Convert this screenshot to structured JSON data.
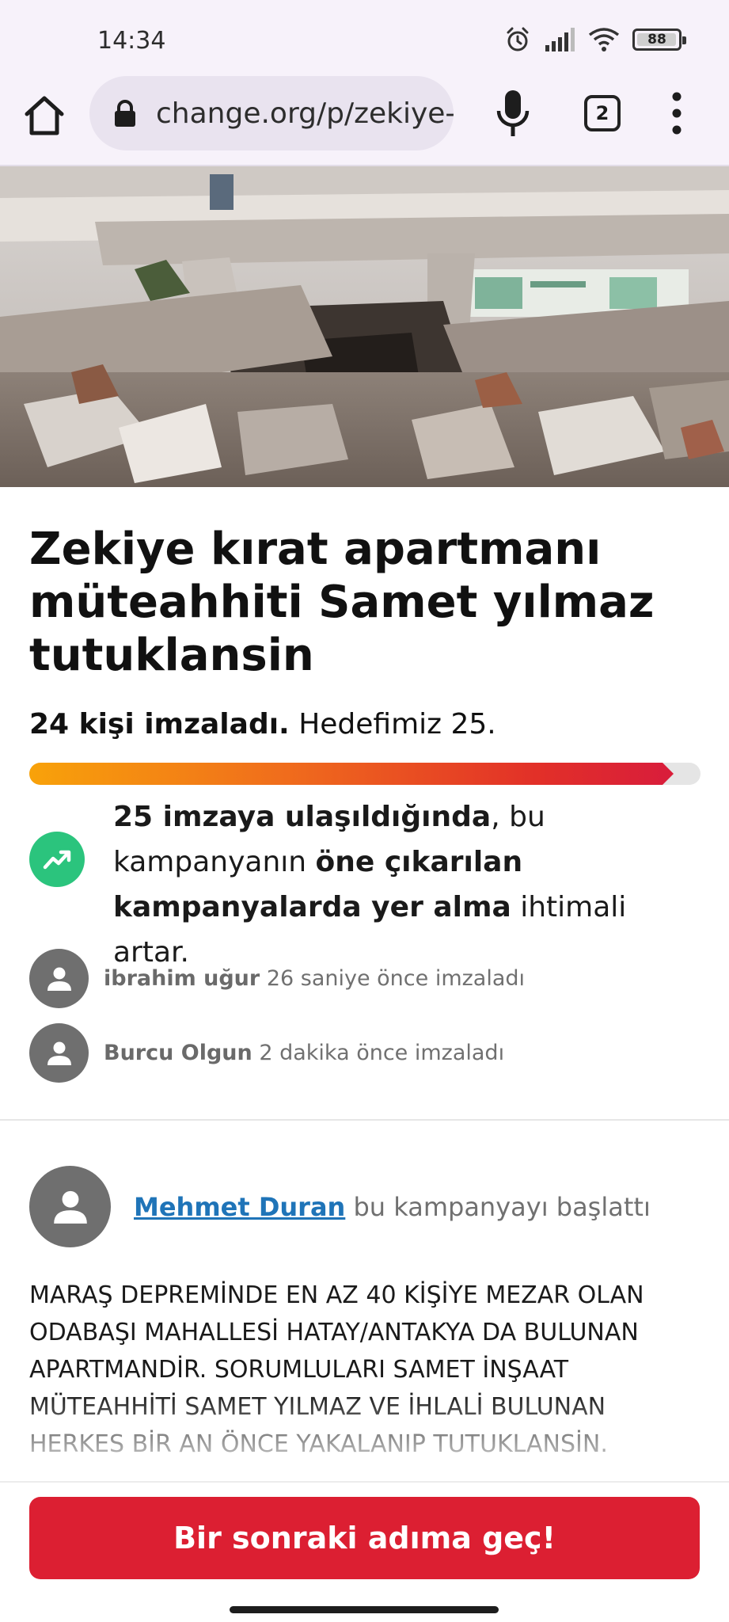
{
  "status_bar": {
    "time": "14:34",
    "battery_level": "88",
    "icons": [
      "alarm-icon",
      "signal-icon",
      "wifi-icon",
      "battery-icon"
    ]
  },
  "browser": {
    "url": "change.org/p/zekiye-kırat-apartmanı",
    "tab_count": "2",
    "icons": [
      "home-icon",
      "lock-icon",
      "mic-icon",
      "tabs-icon",
      "more-vert-icon"
    ]
  },
  "hero": {
    "icon": "collapsed-building-photo"
  },
  "petition": {
    "title": "Zekiye kırat apartmanı müteahhiti Samet yılmaz tutuklansin",
    "signed_bold": "24 kişi imzaladı.",
    "signed_goal": "Hedefimiz 25.",
    "progress_fraction": 0.96,
    "goal_message": {
      "part1_bold": "25 imzaya ulaşıldığında",
      "part2": ", bu kampanyanın ",
      "part3_bold": "öne çıkarılan kampanyalarda yer alma",
      "part4": " ihtimali artar."
    },
    "recent_signers": [
      {
        "name": "ibrahim uğur",
        "time": "26 saniye önce imzaladı"
      },
      {
        "name": "Burcu Olgun",
        "time": "2 dakika önce imzaladı"
      }
    ],
    "starter": {
      "name": "Mehmet Duran",
      "suffix": "bu kampanyayı başlattı"
    },
    "description": "MARAŞ DEPREMİNDE  EN AZ 40 KİŞİYE MEZAR OLAN ODABAŞI MAHALLESİ HATAY/ANTAKYA DA BULUNAN APARTMANDİR. SORUMLULARI SAMET İNŞAAT MÜTEAHHİTİ SAMET YILMAZ VE İHLALİ BULUNAN HERKES BİR AN ÖNCE YAKALANIP TUTUKLANSİN.",
    "cta_label": "Bir sonraki adıma geç!"
  },
  "colors": {
    "accent_red": "#dc1f32",
    "link_blue": "#1f74b8",
    "goal_green": "#2bc47d",
    "progress_start": "#f8a20a",
    "progress_end": "#d91e3a"
  }
}
